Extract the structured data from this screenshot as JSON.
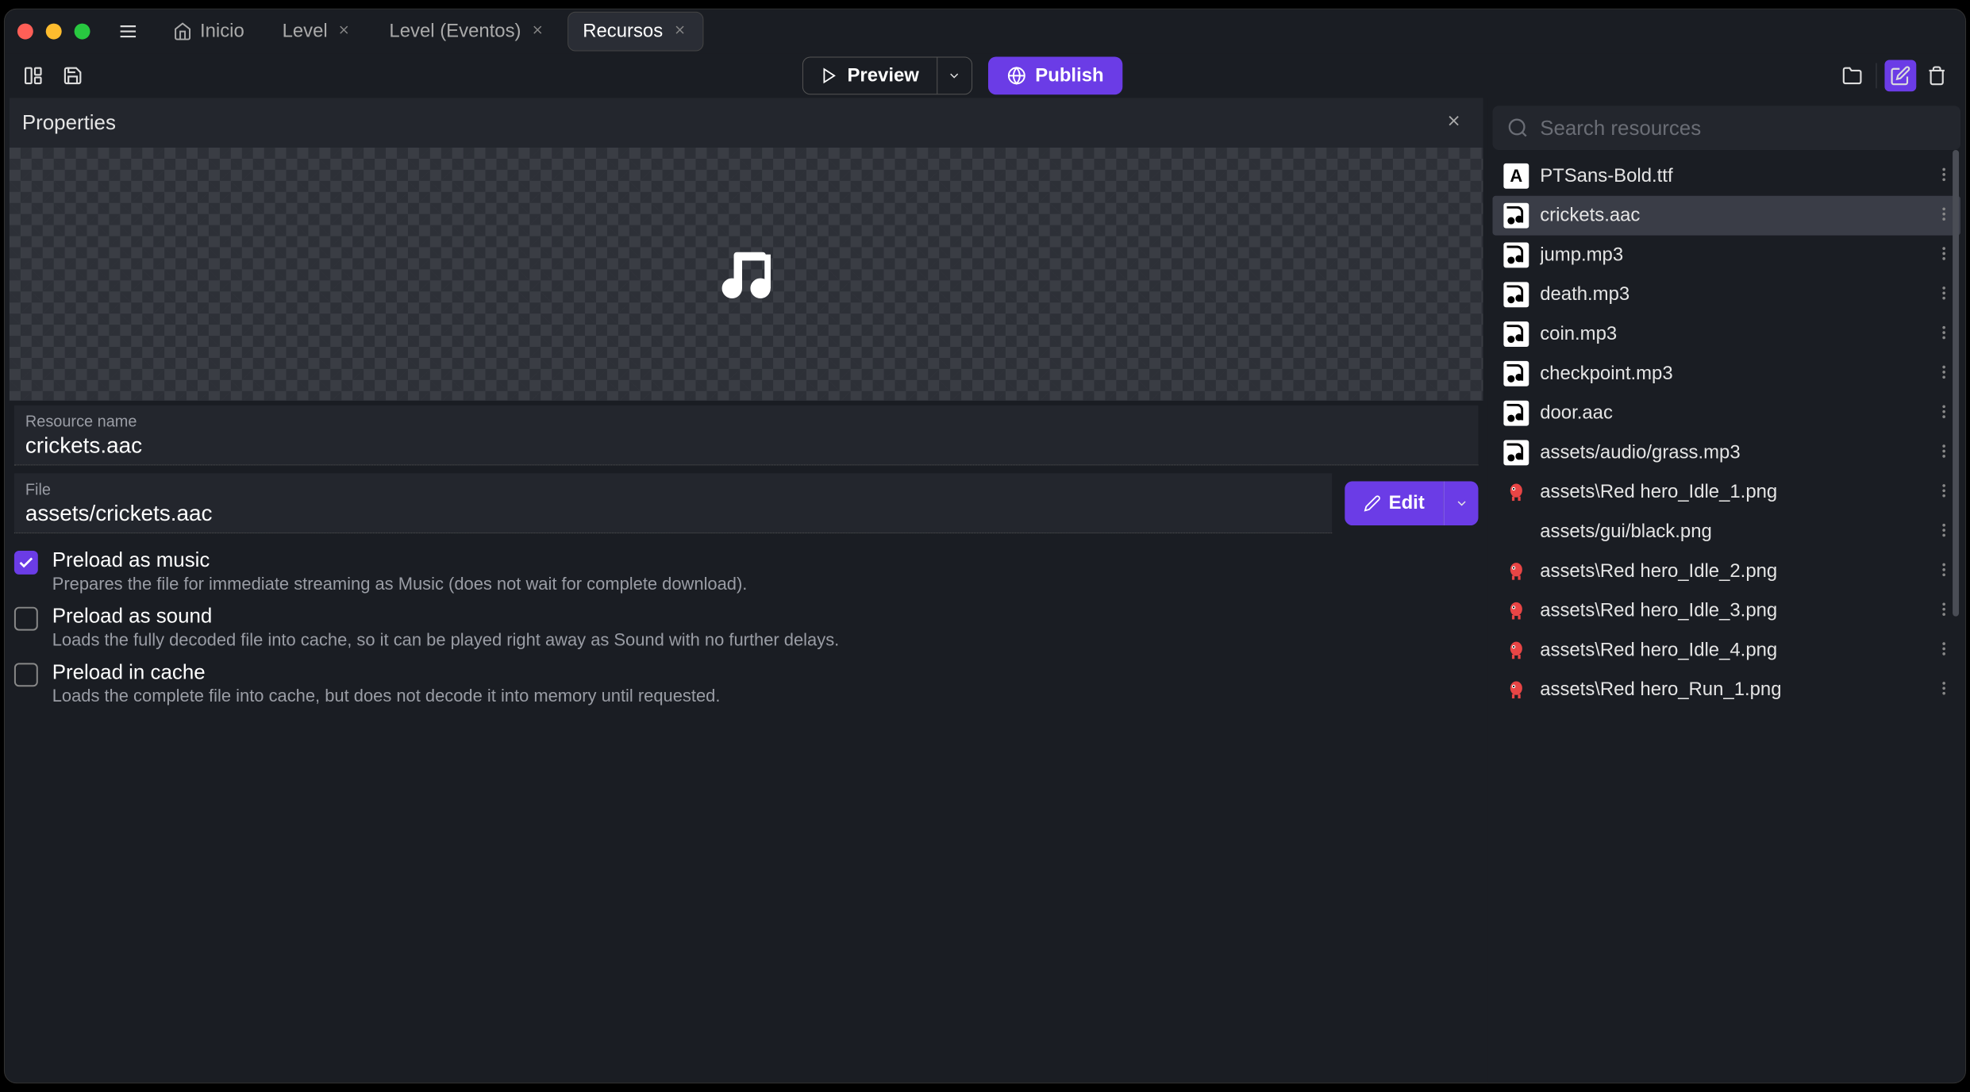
{
  "header": {
    "tabs": [
      {
        "label": "Inicio",
        "home": true
      },
      {
        "label": "Level",
        "closable": true
      },
      {
        "label": "Level (Eventos)",
        "closable": true
      },
      {
        "label": "Recursos",
        "closable": true,
        "active": true
      }
    ],
    "preview_label": "Preview",
    "publish_label": "Publish"
  },
  "properties": {
    "panel_title": "Properties",
    "resource_name_label": "Resource name",
    "resource_name_value": "crickets.aac",
    "file_label": "File",
    "file_value": "assets/crickets.aac",
    "edit_label": "Edit",
    "checks": [
      {
        "title": "Preload as music",
        "desc": "Prepares the file for immediate streaming as Music (does not wait for complete download).",
        "checked": true
      },
      {
        "title": "Preload as sound",
        "desc": "Loads the fully decoded file into cache, so it can be played right away as Sound with no further delays.",
        "checked": false
      },
      {
        "title": "Preload in cache",
        "desc": "Loads the complete file into cache, but does not decode it into memory until requested.",
        "checked": false
      }
    ]
  },
  "resources": {
    "search_placeholder": "Search resources",
    "items": [
      {
        "type": "font",
        "name": "PTSans-Bold.ttf"
      },
      {
        "type": "audio",
        "name": "crickets.aac",
        "selected": true
      },
      {
        "type": "audio",
        "name": "jump.mp3"
      },
      {
        "type": "audio",
        "name": "death.mp3"
      },
      {
        "type": "audio",
        "name": "coin.mp3"
      },
      {
        "type": "audio",
        "name": "checkpoint.mp3"
      },
      {
        "type": "audio",
        "name": "door.aac"
      },
      {
        "type": "audio",
        "name": "assets/audio/grass.mp3"
      },
      {
        "type": "sprite",
        "name": "assets\\Red hero_Idle_1.png"
      },
      {
        "type": "blank",
        "name": "assets/gui/black.png"
      },
      {
        "type": "sprite",
        "name": "assets\\Red hero_Idle_2.png"
      },
      {
        "type": "sprite",
        "name": "assets\\Red hero_Idle_3.png"
      },
      {
        "type": "sprite",
        "name": "assets\\Red hero_Idle_4.png"
      },
      {
        "type": "sprite",
        "name": "assets\\Red hero_Run_1.png"
      }
    ]
  }
}
